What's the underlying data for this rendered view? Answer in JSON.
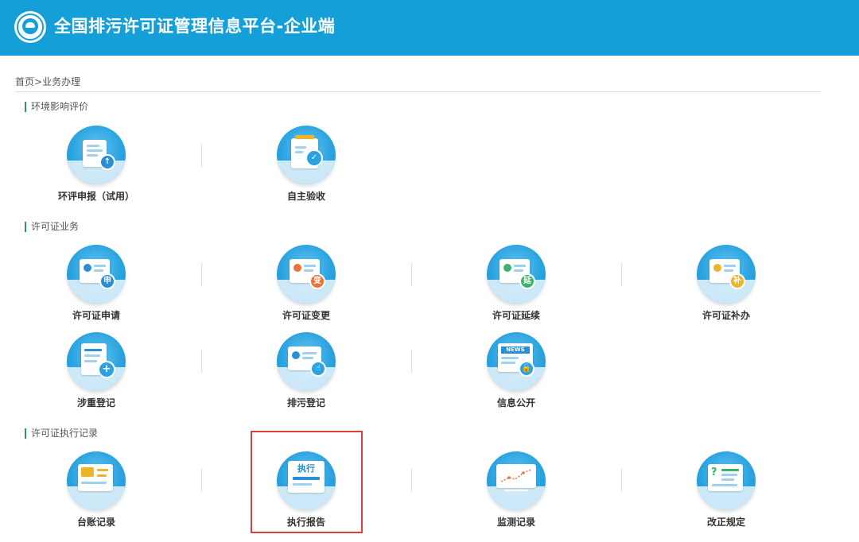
{
  "header": {
    "title": "全国排污许可证管理信息平台-企业端",
    "logo_icon": "ministry-emblem-icon",
    "background": "#159fd9"
  },
  "breadcrumb": {
    "home": "首页",
    "separator": ">",
    "current": "业务办理"
  },
  "sections": [
    {
      "title": "环境影响评价",
      "tiles": [
        {
          "label": "环评申报（试用）",
          "icon": "eia-report-upload-icon"
        },
        {
          "label": "自主验收",
          "icon": "self-acceptance-check-icon"
        }
      ]
    },
    {
      "title": "许可证业务",
      "tiles": [
        {
          "label": "许可证申请",
          "icon": "license-apply-icon",
          "badge": "申"
        },
        {
          "label": "许可证变更",
          "icon": "license-change-icon",
          "badge": "变"
        },
        {
          "label": "许可证延续",
          "icon": "license-renew-icon",
          "badge": "延"
        },
        {
          "label": "许可证补办",
          "icon": "license-reissue-icon",
          "badge": "补"
        },
        {
          "label": "涉重登记",
          "icon": "heavy-metal-register-icon"
        },
        {
          "label": "排污登记",
          "icon": "discharge-register-icon"
        },
        {
          "label": "信息公开",
          "icon": "info-disclosure-icon",
          "badge": "NEWS"
        }
      ]
    },
    {
      "title": "许可证执行记录",
      "tiles": [
        {
          "label": "台账记录",
          "icon": "ledger-record-icon"
        },
        {
          "label": "执行报告",
          "icon": "execution-report-icon",
          "badge": "执行"
        },
        {
          "label": "监测记录",
          "icon": "monitoring-record-icon"
        },
        {
          "label": "改正规定",
          "icon": "correction-rules-icon"
        }
      ]
    }
  ],
  "colors": {
    "accent": "#159fd9",
    "section_marker": "#2a9a5a",
    "highlight": "#d9403a",
    "badge_apply": "#2a8fd6",
    "badge_change": "#e8743a",
    "badge_renew": "#3bb36a",
    "badge_reissue": "#f0b429"
  }
}
